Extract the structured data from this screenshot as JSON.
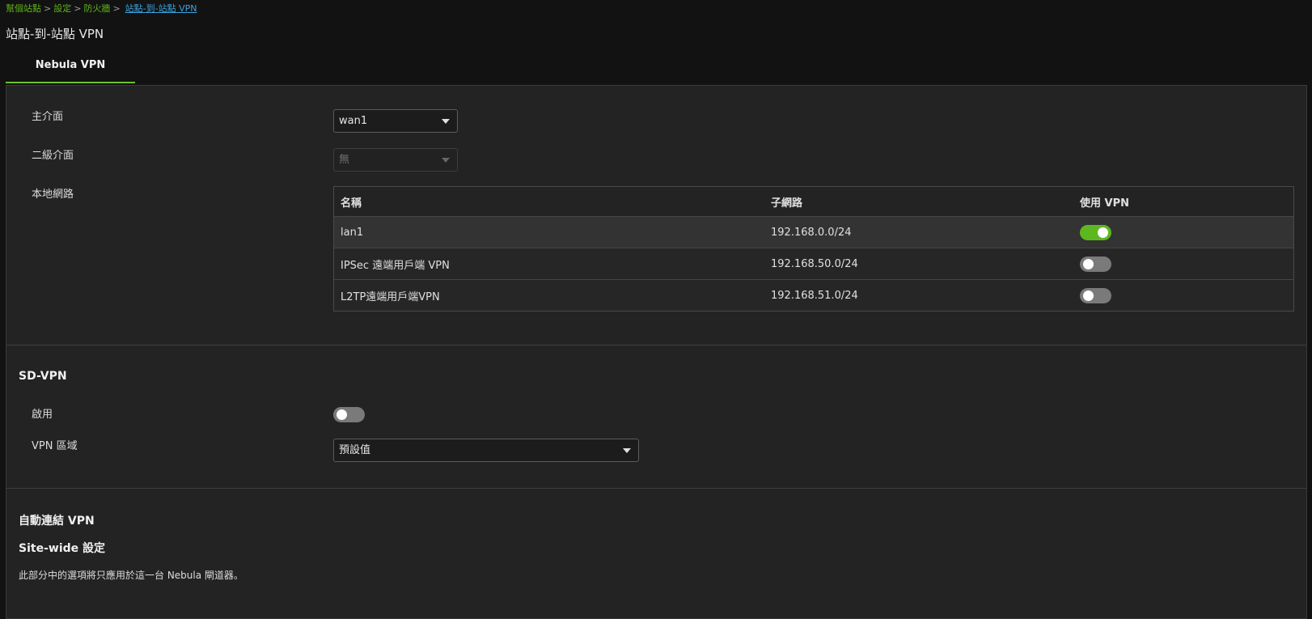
{
  "breadcrumb": {
    "items": [
      "幫個站點",
      "設定",
      "防火牆"
    ],
    "separator": ">",
    "current": "站點-到-站點 VPN"
  },
  "page_title": "站點-到-站點 VPN",
  "tab": {
    "label": "Nebula VPN"
  },
  "form": {
    "primary_interface": {
      "label": "主介面",
      "value": "wan1"
    },
    "secondary_interface": {
      "label": "二級介面",
      "value": "無"
    },
    "local_networks": {
      "label": "本地網路",
      "columns": [
        "名稱",
        "子網路",
        "使用 VPN"
      ],
      "rows": [
        {
          "name": "lan1",
          "subnet": "192.168.0.0/24",
          "use_vpn": true
        },
        {
          "name": "IPSec 遠端用戶端 VPN",
          "subnet": "192.168.50.0/24",
          "use_vpn": false
        },
        {
          "name": "L2TP遠端用戶端VPN",
          "subnet": "192.168.51.0/24",
          "use_vpn": false
        }
      ]
    }
  },
  "sdvpn": {
    "title": "SD-VPN",
    "enable_label": "啟用",
    "enabled": false,
    "area_label": "VPN 區域",
    "area_value": "預設值"
  },
  "auto_vpn": {
    "title": "自動連結 VPN",
    "sitewide_title": "Site-wide 設定",
    "note": "此部分中的選項將只應用於這一台 Nebula 閘道器。"
  },
  "colors": {
    "accent": "#5db71f",
    "link": "#3aa3e0",
    "panel": "#232323"
  }
}
